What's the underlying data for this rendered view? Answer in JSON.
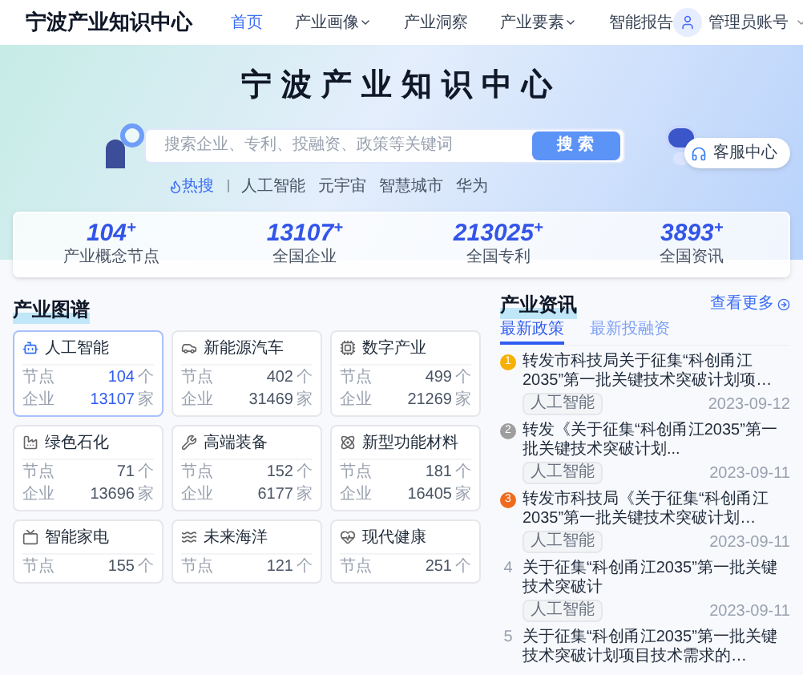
{
  "header": {
    "logo_text": "宁波产业知识中心",
    "nav": [
      {
        "label": "首页",
        "selected": true,
        "dropdown": false
      },
      {
        "label": "产业画像",
        "selected": false,
        "dropdown": true
      },
      {
        "label": "产业洞察",
        "selected": false,
        "dropdown": false
      },
      {
        "label": "产业要素",
        "selected": false,
        "dropdown": true
      },
      {
        "label": "智能报告",
        "selected": false,
        "dropdown": false
      }
    ],
    "user": {
      "name": "管理员账号"
    }
  },
  "hero": {
    "title": "宁波产业知识中心",
    "search": {
      "placeholder": "搜索企业、专利、投融资、政策等关键词",
      "button": "搜 索"
    },
    "hot_label": "热搜",
    "hot_words": [
      "人工智能",
      "元宇宙",
      "智慧城市",
      "华为"
    ]
  },
  "stats": [
    {
      "value": "104",
      "suffix": "+",
      "label": "产业概念节点"
    },
    {
      "value": "13107",
      "suffix": "+",
      "label": "全国企业"
    },
    {
      "value": "213025",
      "suffix": "+",
      "label": "全国专利"
    },
    {
      "value": "3893",
      "suffix": "+",
      "label": "全国资讯"
    }
  ],
  "graph": {
    "title": "产业图谱",
    "cards": [
      {
        "kind": "ai",
        "name": "人工智能",
        "selected": true,
        "rows": [
          {
            "label": "节点",
            "value": "104",
            "unit": "个"
          },
          {
            "label": "企业",
            "value": "13107",
            "unit": "家"
          }
        ]
      },
      {
        "kind": "car",
        "name": "新能源汽车",
        "selected": false,
        "rows": [
          {
            "label": "节点",
            "value": "402",
            "unit": "个"
          },
          {
            "label": "企业",
            "value": "31469",
            "unit": "家"
          }
        ]
      },
      {
        "kind": "digital",
        "name": "数字产业",
        "selected": false,
        "rows": [
          {
            "label": "节点",
            "value": "499",
            "unit": "个"
          },
          {
            "label": "企业",
            "value": "21269",
            "unit": "家"
          }
        ]
      },
      {
        "kind": "petro",
        "name": "绿色石化",
        "selected": false,
        "rows": [
          {
            "label": "节点",
            "value": "71",
            "unit": "个"
          },
          {
            "label": "企业",
            "value": "13696",
            "unit": "家"
          }
        ]
      },
      {
        "kind": "equip",
        "name": "高端装备",
        "selected": false,
        "rows": [
          {
            "label": "节点",
            "value": "152",
            "unit": "个"
          },
          {
            "label": "企业",
            "value": "6177",
            "unit": "家"
          }
        ]
      },
      {
        "kind": "material",
        "name": "新型功能材料",
        "selected": false,
        "rows": [
          {
            "label": "节点",
            "value": "181",
            "unit": "个"
          },
          {
            "label": "企业",
            "value": "16405",
            "unit": "家"
          }
        ]
      },
      {
        "kind": "appliance",
        "name": "智能家电",
        "selected": false,
        "rows": [
          {
            "label": "节点",
            "value": "155",
            "unit": "个"
          }
        ]
      },
      {
        "kind": "ocean",
        "name": "未来海洋",
        "selected": false,
        "rows": [
          {
            "label": "节点",
            "value": "121",
            "unit": "个"
          }
        ]
      },
      {
        "kind": "health",
        "name": "现代健康",
        "selected": false,
        "rows": [
          {
            "label": "节点",
            "value": "251",
            "unit": "个"
          }
        ]
      }
    ]
  },
  "news": {
    "title": "产业资讯",
    "more": "查看更多",
    "tabs": [
      {
        "label": "最新政策",
        "selected": true
      },
      {
        "label": "最新投融资",
        "selected": false
      }
    ],
    "items": [
      {
        "rank": "1",
        "kind": "badge",
        "color": "#f5b000",
        "title": "转发市科技局关于征集“科创甬江2035”第一批关键技术突破计划项…",
        "tag": "人工智能",
        "date": "2023-09-12"
      },
      {
        "rank": "2",
        "kind": "badge",
        "color": "#9e9e9e",
        "title": "转发《关于征集“科创甬江2035”第一批关键技术突破计划...",
        "tag": "人工智能",
        "date": "2023-09-11"
      },
      {
        "rank": "3",
        "kind": "badge",
        "color": "#f06a1e",
        "title": "转发市科技局《关于征集“科创甬江2035”第一批关键技术突破计划…",
        "tag": "人工智能",
        "date": "2023-09-11"
      },
      {
        "rank": "4",
        "kind": "plain",
        "title": "关于征集“科创甬江2035”第一批关键技术突破计",
        "tag": "人工智能",
        "date": "2023-09-11"
      },
      {
        "rank": "5",
        "kind": "plain",
        "title": "关于征集“科创甬江2035”第一批关键技术突破计划项目技术需求的…"
      }
    ]
  },
  "float_button": {
    "label": "客服中心"
  }
}
